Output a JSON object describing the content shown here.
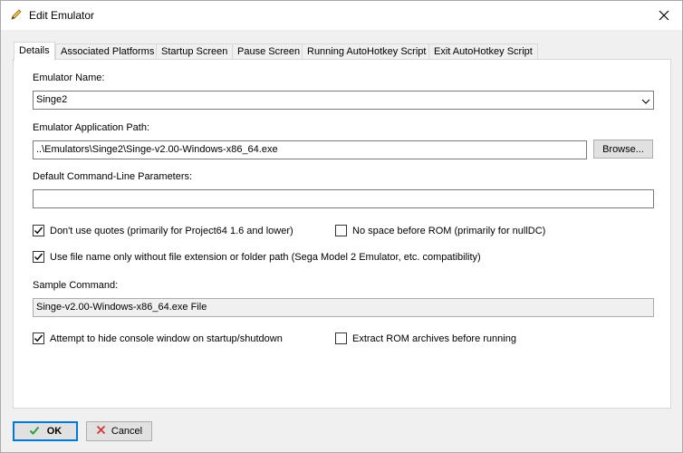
{
  "window": {
    "title": "Edit Emulator",
    "title_icon": "pencil-icon",
    "close_icon": "close-icon"
  },
  "tabs": [
    {
      "label": "Details",
      "active": true
    },
    {
      "label": "Associated Platforms",
      "active": false
    },
    {
      "label": "Startup Screen",
      "active": false
    },
    {
      "label": "Pause Screen",
      "active": false
    },
    {
      "label": "Running AutoHotkey Script",
      "active": false
    },
    {
      "label": "Exit AutoHotkey Script",
      "active": false
    }
  ],
  "details": {
    "emulator_name_label": "Emulator Name:",
    "emulator_name_value": "Singe2",
    "app_path_label": "Emulator Application Path:",
    "app_path_value": "..\\Emulators\\Singe2\\Singe-v2.00-Windows-x86_64.exe",
    "browse_label": "Browse...",
    "params_label": "Default Command-Line Parameters:",
    "params_value": "",
    "chk_no_quotes": {
      "label": "Don't use quotes (primarily for Project64 1.6 and lower)",
      "checked": true
    },
    "chk_no_space": {
      "label": "No space before ROM (primarily for nullDC)",
      "checked": false
    },
    "chk_filename_only": {
      "label": "Use file name only without file extension or folder path (Sega Model 2 Emulator, etc. compatibility)",
      "checked": true
    },
    "sample_label": "Sample Command:",
    "sample_value": "Singe-v2.00-Windows-x86_64.exe File",
    "chk_hide_console": {
      "label": "Attempt to hide console window on startup/shutdown",
      "checked": true
    },
    "chk_extract_rom": {
      "label": "Extract ROM archives before running",
      "checked": false
    }
  },
  "footer": {
    "ok_label": "OK",
    "ok_icon": "checkmark-icon",
    "cancel_label": "Cancel",
    "cancel_icon": "red-x-icon"
  },
  "colors": {
    "accent": "#0078d7",
    "ok_check": "#2e9e3a",
    "cancel_x": "#d23a3a"
  }
}
